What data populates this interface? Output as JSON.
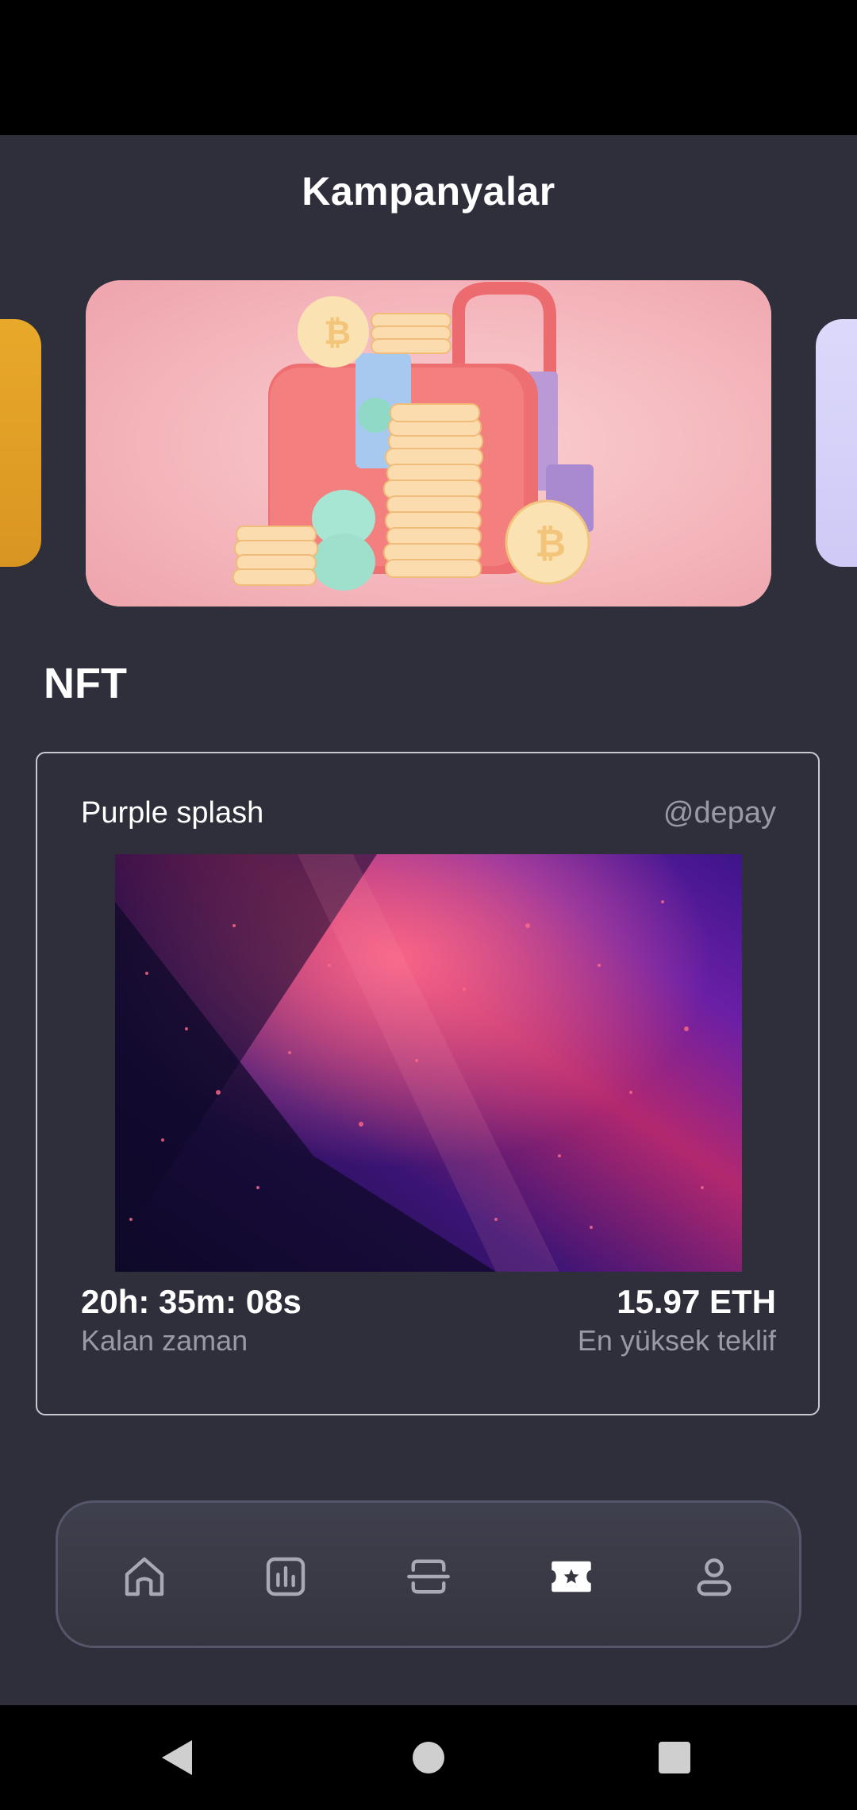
{
  "header": {
    "title": "Kampanyalar"
  },
  "sections": {
    "nft_title": "NFT"
  },
  "nft_card": {
    "name": "Purple splash",
    "handle": "@depay",
    "time_remaining": "20h: 35m: 08s",
    "time_label": "Kalan zaman",
    "highest_bid": "15.97 ETH",
    "bid_label": "En yüksek teklif"
  },
  "bottom_nav": {
    "tabs": [
      {
        "icon": "home-icon",
        "active": false
      },
      {
        "icon": "chart-icon",
        "active": false
      },
      {
        "icon": "scan-icon",
        "active": false
      },
      {
        "icon": "ticket-star-icon",
        "active": true
      },
      {
        "icon": "user-icon",
        "active": false
      }
    ]
  },
  "colors": {
    "background": "#2e2f3a",
    "text_primary": "#ffffff",
    "text_secondary": "#9a9aa4",
    "nav_icon": "#a9a9b3",
    "nav_active_icon": "#ffffff",
    "left_card": "#e8a92a",
    "right_card": "#dcd9fb"
  }
}
